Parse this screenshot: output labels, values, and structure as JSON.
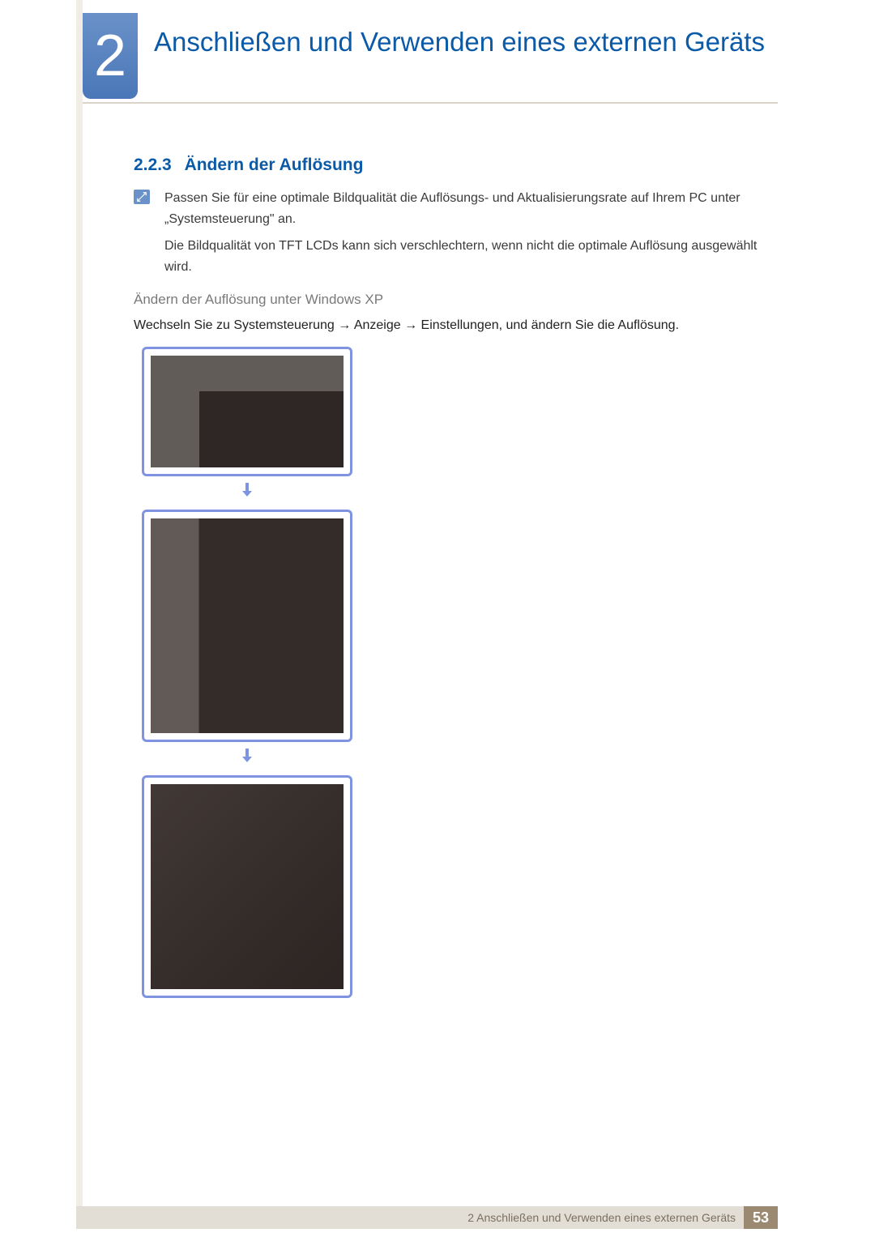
{
  "chapter": {
    "number": "2",
    "title": "Anschließen und Verwenden eines externen Geräts"
  },
  "section": {
    "number": "2.2.3",
    "title": "Ändern der Auflösung"
  },
  "note": {
    "p1": "Passen Sie für eine optimale Bildqualität die Auflösungs- und Aktualisierungsrate auf Ihrem PC unter „Systemsteuerung\" an.",
    "p2": "Die Bildqualität von TFT LCDs kann sich verschlechtern, wenn nicht die optimale Auflösung ausgewählt wird."
  },
  "subheading": "Ändern der Auflösung unter Windows XP",
  "instruction": "Wechseln Sie zu Systemsteuerung → Anzeige → Einstellungen, und ändern Sie die Auflösung.",
  "footer": {
    "text": "2 Anschließen und Verwenden eines externen Geräts",
    "page": "53"
  }
}
